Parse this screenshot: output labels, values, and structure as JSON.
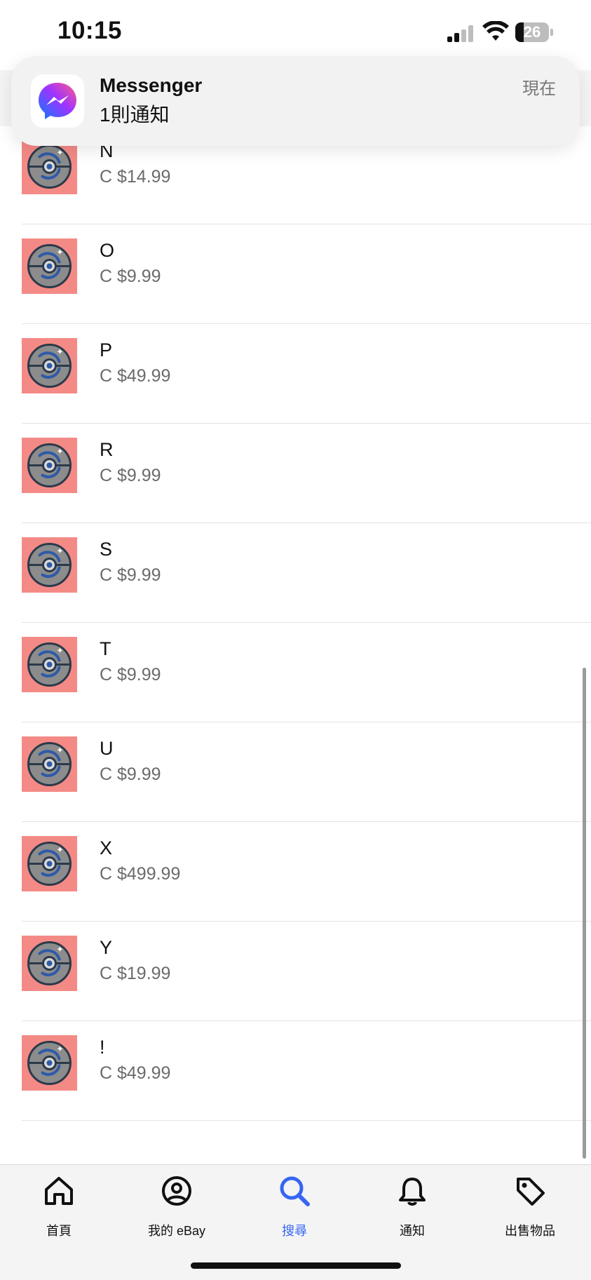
{
  "status_bar": {
    "time": "10:15",
    "battery_level": "26",
    "signal_icon": "cellular-signal-icon",
    "wifi_icon": "wifi-icon"
  },
  "notification": {
    "app_name": "Messenger",
    "message": "1則通知",
    "time": "現在",
    "icon": "messenger-icon"
  },
  "listing": {
    "thumbnail_icon": "pokeball-unown-icon",
    "items": [
      {
        "name": "N",
        "price": "C $14.99"
      },
      {
        "name": "O",
        "price": "C $9.99"
      },
      {
        "name": "P",
        "price": "C $49.99"
      },
      {
        "name": "R",
        "price": "C $9.99"
      },
      {
        "name": "S",
        "price": "C $9.99"
      },
      {
        "name": "T",
        "price": "C $9.99"
      },
      {
        "name": "U",
        "price": "C $9.99"
      },
      {
        "name": "X",
        "price": "C $499.99"
      },
      {
        "name": "Y",
        "price": "C $19.99"
      },
      {
        "name": "!",
        "price": "C $49.99"
      }
    ]
  },
  "bottom_nav": {
    "active": "search",
    "active_color": "#3665f3",
    "items": [
      {
        "label": "首頁",
        "icon": "home-icon"
      },
      {
        "label": "我的 eBay",
        "icon": "user-circle-icon"
      },
      {
        "label": "搜尋",
        "icon": "search-icon"
      },
      {
        "label": "通知",
        "icon": "bell-icon"
      },
      {
        "label": "出售物品",
        "icon": "tag-icon"
      }
    ]
  }
}
